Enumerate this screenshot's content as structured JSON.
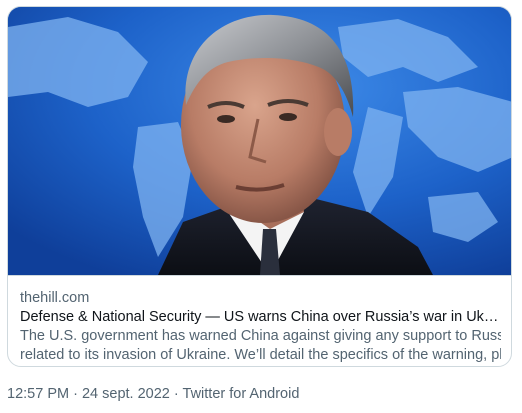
{
  "card": {
    "domain": "thehill.com",
    "headline": "Defense & National Security — US warns China over Russia’s war in Ukraine",
    "description_line1": "The U.S. government has warned China against giving any support to Russia",
    "description_line2": "related to its invasion of Ukraine.  We’ll detail the specifics of the warning, plus...",
    "image_description_icon": "news-photo"
  },
  "meta": {
    "time": "12:57 PM",
    "separator": "·",
    "date": "24 sept. 2022",
    "source": "Twitter for Android"
  },
  "colors": {
    "border": "#cfd9de",
    "secondary_text": "#536471",
    "primary_text": "#0f1419",
    "photo_background": "#1a5fc7"
  }
}
